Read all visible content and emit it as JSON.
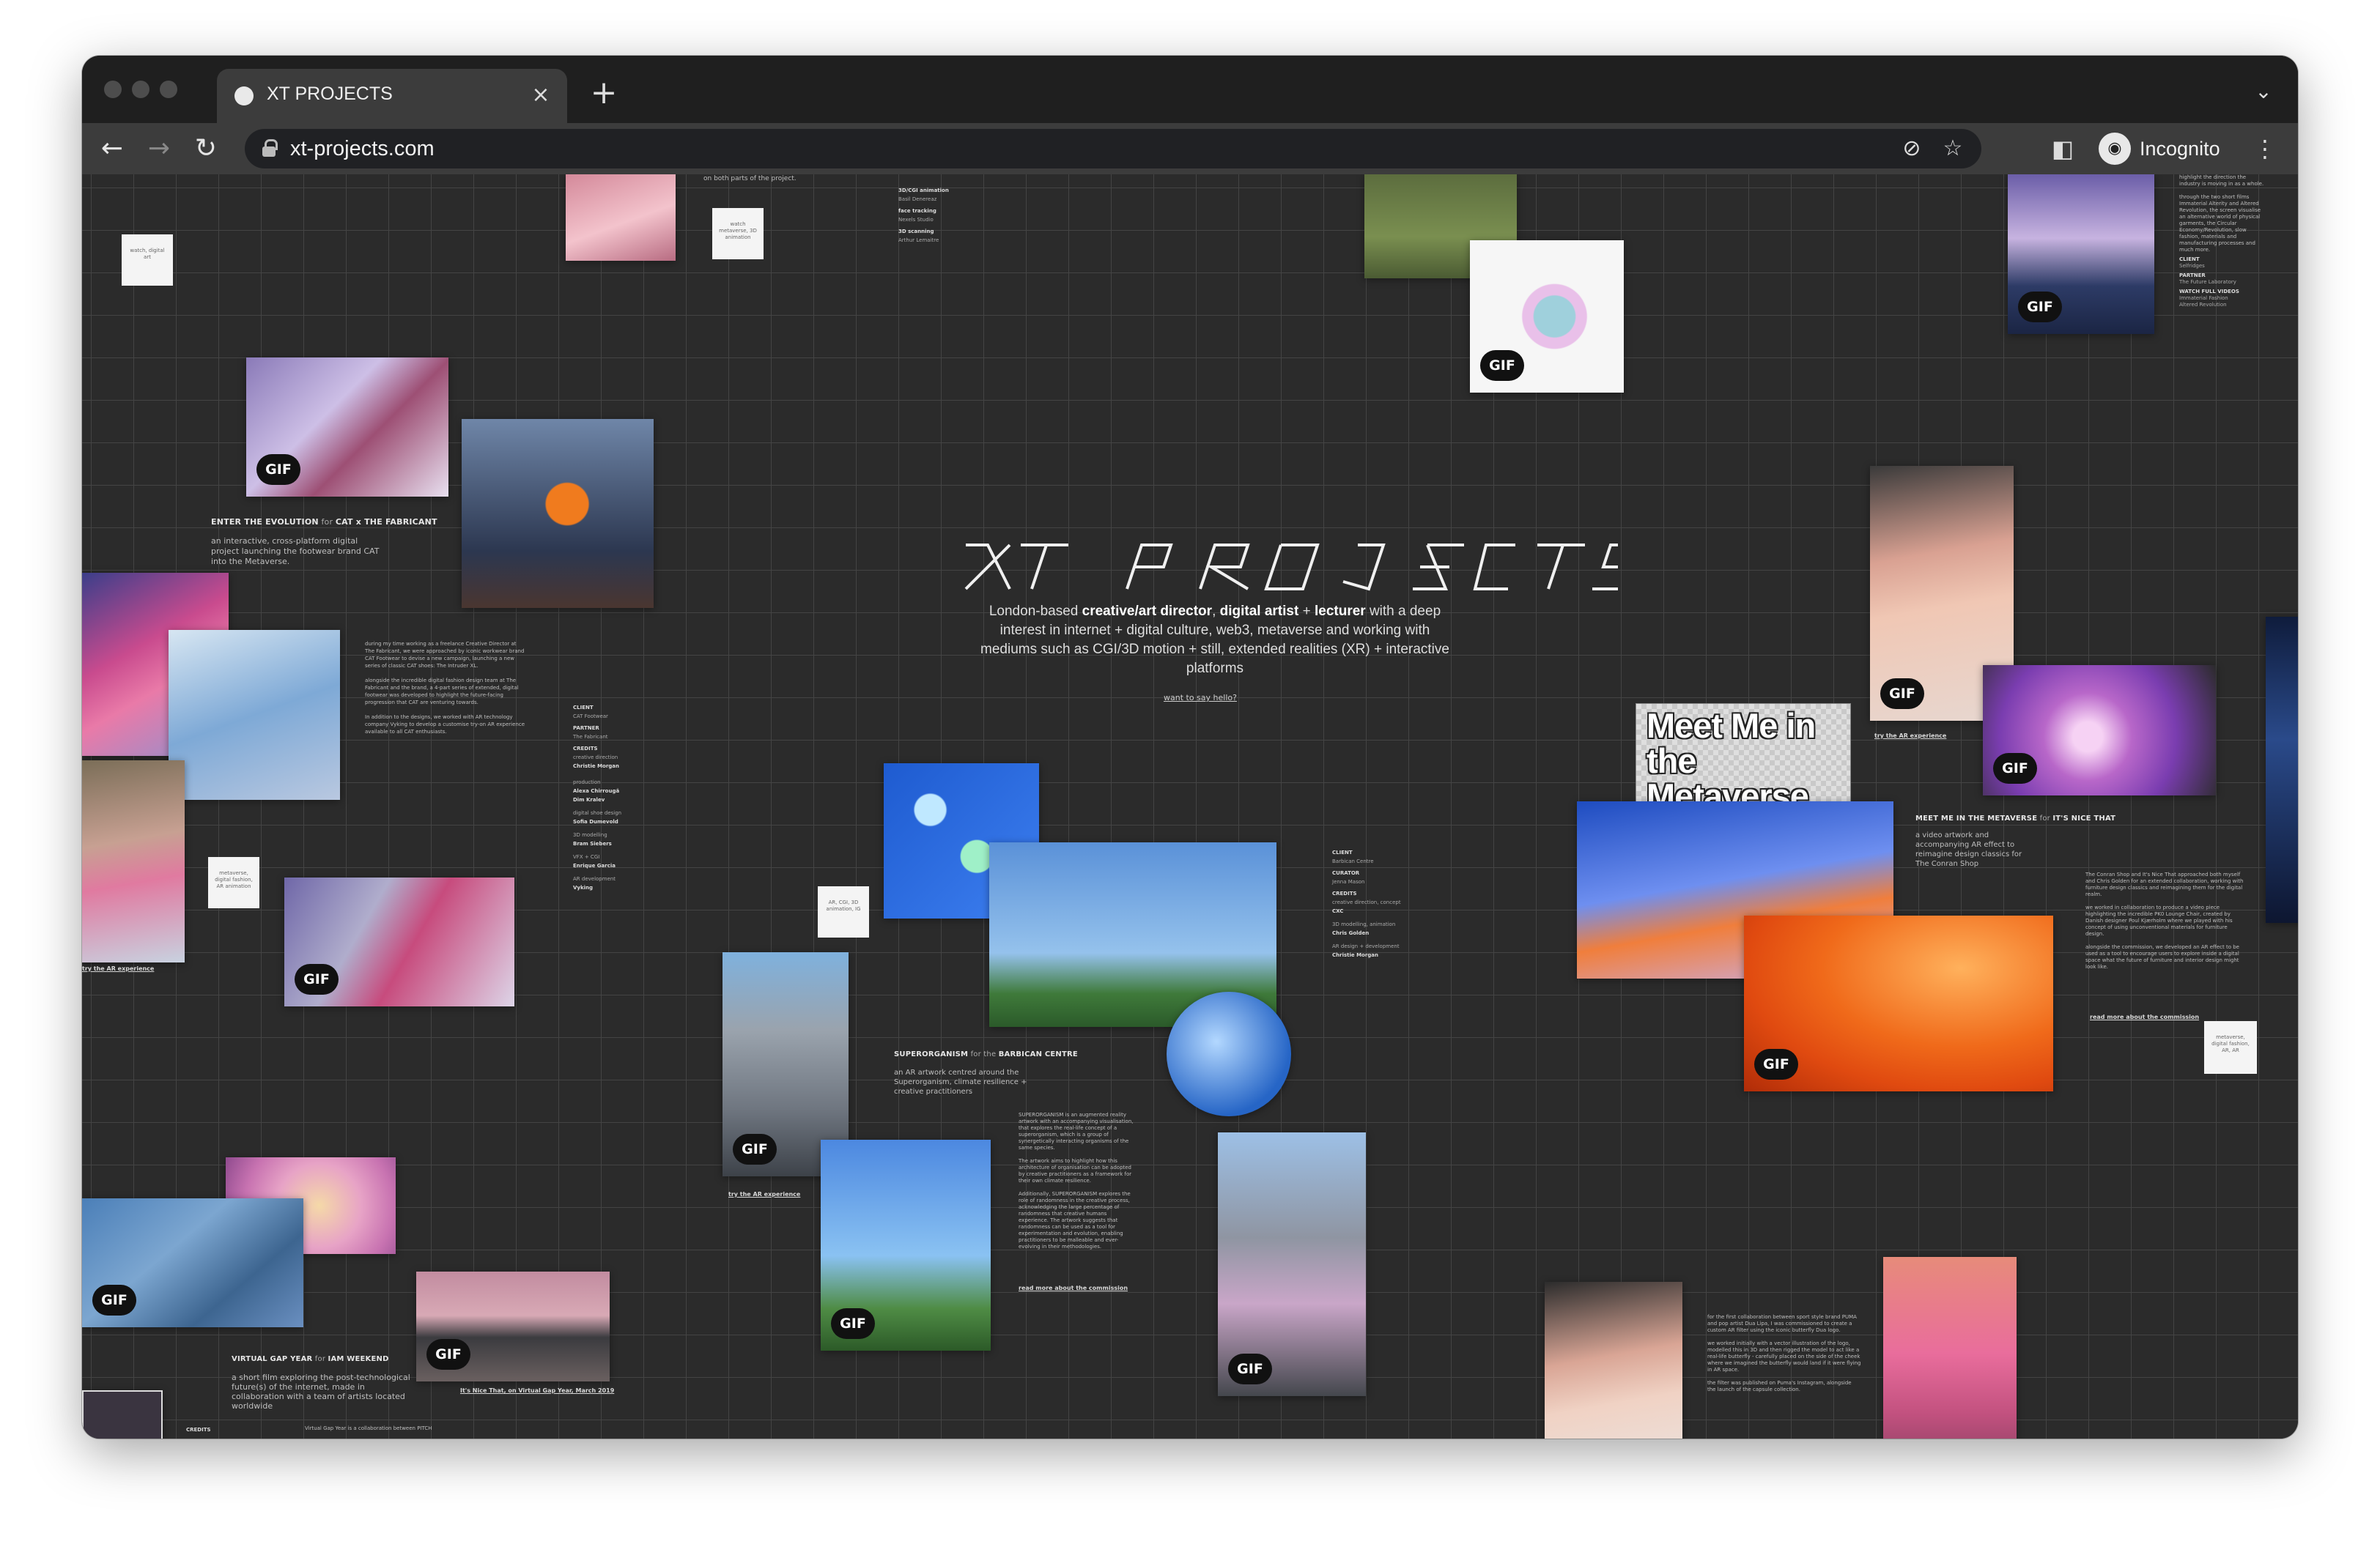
{
  "browser": {
    "tab_title": "XT PROJECTS",
    "url": "xt-projects.com",
    "profile_label": "Incognito",
    "new_tab_symbol": "+",
    "close_symbol": "×"
  },
  "hero": {
    "logo_text": "XT PROJECTS",
    "intro_parts": [
      {
        "text": "London-based ",
        "bold": false
      },
      {
        "text": "creative/art director",
        "bold": true
      },
      {
        "text": ", ",
        "bold": false
      },
      {
        "text": "digital artist",
        "bold": true
      },
      {
        "text": " + ",
        "bold": false
      },
      {
        "text": "lecturer",
        "bold": true
      },
      {
        "text": " with a deep interest in internet + digital culture, web3, metaverse and working with mediums such as CGI/3D motion + still, extended realities (XR) + interactive platforms",
        "bold": false
      }
    ],
    "contact_link": "want to say hello?"
  },
  "gif_label": "GIF",
  "projects": {
    "cat": {
      "title_parts": [
        {
          "text": "ENTER THE EVOLUTION",
          "bold": true
        },
        {
          "text": " for ",
          "bold": false
        },
        {
          "text": "CAT x THE FABRICANT",
          "bold": true
        }
      ],
      "subtitle": "an interactive, cross-platform digital project launching the footwear brand CAT into the Metaverse.",
      "body": "during my time working as a freelance Creative Director at The Fabricant, we were approached by iconic workwear brand CAT Footwear to devise a new campaign, launching a new series of classic CAT shoes: The Intruder XL.",
      "body2": "alongside the incredible digital fashion design team at The Fabricant and the brand, a 4-part series of extended, digital footwear was developed to highlight the future-facing progression that CAT are venturing towards.",
      "body3": "In addition to the designs, we worked with AR technology company Vyking to develop a customise try-on AR experience available to all CAT enthusiasts.",
      "credits": [
        {
          "label": "CLIENT",
          "value": "CAT Footwear"
        },
        {
          "label": "PARTNER",
          "value": "The Fabricant"
        },
        {
          "label": "CREDITS",
          "value": "creative direction"
        },
        {
          "label": "",
          "value": "Christie Morgan"
        },
        {
          "label": "production",
          "value": "Alexa Chirrougä"
        },
        {
          "label": "",
          "value": "Dim Kralev"
        },
        {
          "label": "digital shoe design",
          "value": "Sofia Dumevold"
        },
        {
          "label": "3D modelling",
          "value": "Bram Siebers"
        },
        {
          "label": "VFX + CGI",
          "value": "Enrique Garcia"
        },
        {
          "label": "AR development",
          "value": "Vyking"
        }
      ],
      "ar_link": "try the AR experience"
    },
    "superorganism": {
      "title_parts": [
        {
          "text": "SUPERORGANISM",
          "bold": true
        },
        {
          "text": " for the ",
          "bold": false
        },
        {
          "text": "BARBICAN CENTRE",
          "bold": true
        }
      ],
      "subtitle": "an AR artwork centred around the Superorganism, climate resilience + creative practitioners",
      "body": "SUPERORGANISM is an augmented reality artwork with an accompanying visualisation, that explores the real-life concept of a superorganism, which is a group of synergetically interacting organisms of the same species.",
      "body2": "The artwork aims to highlight how this architecture of organisation can be adopted by creative practitioners as a framework for their own climate resilience.",
      "body3": "Additionally, SUPERORGANISM explores the role of randomness in the creative process, acknowledging the large percentage of randomness that creative humans experience. The artwork suggests that randomness can be used as a tool for experimentation and evolution, enabling practitioners to be malleable and ever-evolving in their methodologies.",
      "credits": [
        {
          "label": "CLIENT",
          "value": "Barbican Centre"
        },
        {
          "label": "CURATOR",
          "value": "Jenna Mason"
        },
        {
          "label": "CREDITS",
          "value": "creative direction, concept"
        },
        {
          "label": "",
          "value": "CXC"
        },
        {
          "label": "3D modelling, animation",
          "value": "Chris Golden"
        },
        {
          "label": "AR design + development",
          "value": "Christie Morgan"
        }
      ],
      "ar_link": "try the AR experience",
      "more_link": "read more about the commission"
    },
    "meet": {
      "poster_text": "Meet Me in the Metaverse",
      "title_parts": [
        {
          "text": "MEET ME IN THE METAVERSE",
          "bold": true
        },
        {
          "text": " for ",
          "bold": false
        },
        {
          "text": "IT'S NICE THAT",
          "bold": true
        }
      ],
      "subtitle": "a video artwork and accompanying AR effect to reimagine design classics for The Conran Shop",
      "body": "The Conran Shop and It's Nice That approached both myself and Chris Golden for an extended collaboration, working with furniture design classics and reimagining them for the digital realm.",
      "body2": "we worked in collaboration to produce a video piece highlighting the incredible PK0 Lounge Chair, created by Danish designer Poul Kjærholm where we played with his concept of using unconventional materials for furniture design.",
      "body3": "alongside the commission, we developed an AR effect to be used as a tool to encourage users to explore inside a digital space what the future of furniture and interior design might look like.",
      "ar_link": "try the AR experience",
      "more_link": "read more about the commission"
    },
    "virtual_gap": {
      "title_parts": [
        {
          "text": "VIRTUAL GAP YEAR",
          "bold": true
        },
        {
          "text": " for ",
          "bold": false
        },
        {
          "text": "IAM WEEKEND",
          "bold": true
        }
      ],
      "subtitle": "a short film exploring the post-technological future(s) of the internet, made in collaboration with a team of artists located worldwide",
      "credits_label": "CREDITS",
      "partner_text": "Virtual Gap Year is a collaboration between PITCH",
      "link": "It's Nice That, on Virtual Gap Year, March 2019"
    },
    "puma": {
      "body": "for the first collaboration between sport style brand PUMA and pop artist Dua Lipa, I was commissioned to create a custom AR filter using the iconic butterfly Dua logo.",
      "body2": "we worked initially with a vector illustration of the logo, modelled this in 3D and then rigged the model to act like a real-life butterfly - carefully placed on the side of the cheek where we imagined the butterfly would land if it were flying in AR space.",
      "body3": "the filter was published on Puma's Instagram, alongside the launch of the capsule collection."
    },
    "fabric": {
      "body": "highlight the direction the industry is moving in as a whole.",
      "body2": "through the two short films Immaterial Alterity and Altered Revolution, the screen visualise an alternative world of physical garments, the Circular Economy/Revolution, slow fashion, materials and manufacturing processes and much more.",
      "credits": [
        {
          "label": "CLIENT",
          "value": "Selfridges"
        },
        {
          "label": "PARTNER",
          "value": "The Future Laboratory"
        },
        {
          "label": "WATCH FULL VIDEOS",
          "value": "Immaterial Fashion"
        },
        {
          "label": "",
          "value": "Altered Revolution"
        }
      ]
    },
    "top_credits": [
      {
        "label": "3D/CGI animation",
        "value": "Basil Denereaz"
      },
      {
        "label": "face tracking",
        "value": "Nexels Studio"
      },
      {
        "label": "3D scanning",
        "value": "Arthur Lemaitre"
      }
    ],
    "top_caption": "on both parts of the project."
  },
  "notes": [
    "watch, digital art",
    "watch metaverse, 3D animation",
    "metaverse, digital fashion, AR animation",
    "AR, CGI, 3D animation, IG",
    "metaverse, digital fashion, AR, AR"
  ],
  "colors": {
    "page_bg": "#2b2b2b",
    "grid_line": "#444444",
    "tab_bg": "#3c3c3c",
    "tabstrip_bg": "#1f1f1f"
  }
}
